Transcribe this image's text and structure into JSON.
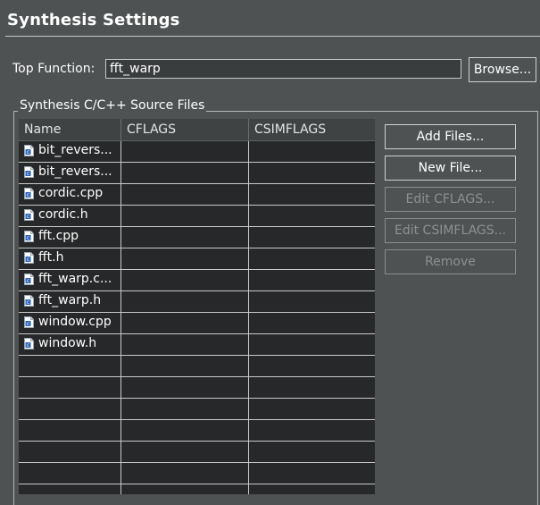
{
  "title": "Synthesis Settings",
  "top_function": {
    "label": "Top Function:",
    "value": "fft_warp",
    "browse_label": "Browse..."
  },
  "source_files": {
    "group_label": "Synthesis C/C++ Source Files",
    "columns": [
      "Name",
      "CFLAGS",
      "CSIMFLAGS"
    ],
    "rows": [
      {
        "name": "bit_revers...",
        "cflags": "",
        "csimflags": ""
      },
      {
        "name": "bit_revers...",
        "cflags": "",
        "csimflags": ""
      },
      {
        "name": "cordic.cpp",
        "cflags": "",
        "csimflags": ""
      },
      {
        "name": "cordic.h",
        "cflags": "",
        "csimflags": ""
      },
      {
        "name": "fft.cpp",
        "cflags": "",
        "csimflags": ""
      },
      {
        "name": "fft.h",
        "cflags": "",
        "csimflags": ""
      },
      {
        "name": "fft_warp.c...",
        "cflags": "",
        "csimflags": ""
      },
      {
        "name": "fft_warp.h",
        "cflags": "",
        "csimflags": ""
      },
      {
        "name": "window.cpp",
        "cflags": "",
        "csimflags": ""
      },
      {
        "name": "window.h",
        "cflags": "",
        "csimflags": ""
      }
    ],
    "file_icon": "c-source-file-icon"
  },
  "buttons": {
    "add_files": "Add Files...",
    "new_file": "New File...",
    "edit_cflags": "Edit CFLAGS...",
    "edit_csimflags": "Edit CSIMFLAGS...",
    "remove": "Remove"
  },
  "colors": {
    "background": "#4e5253",
    "table_background": "#262829",
    "header_background": "#3f4344",
    "disabled_text": "#8d9192"
  }
}
